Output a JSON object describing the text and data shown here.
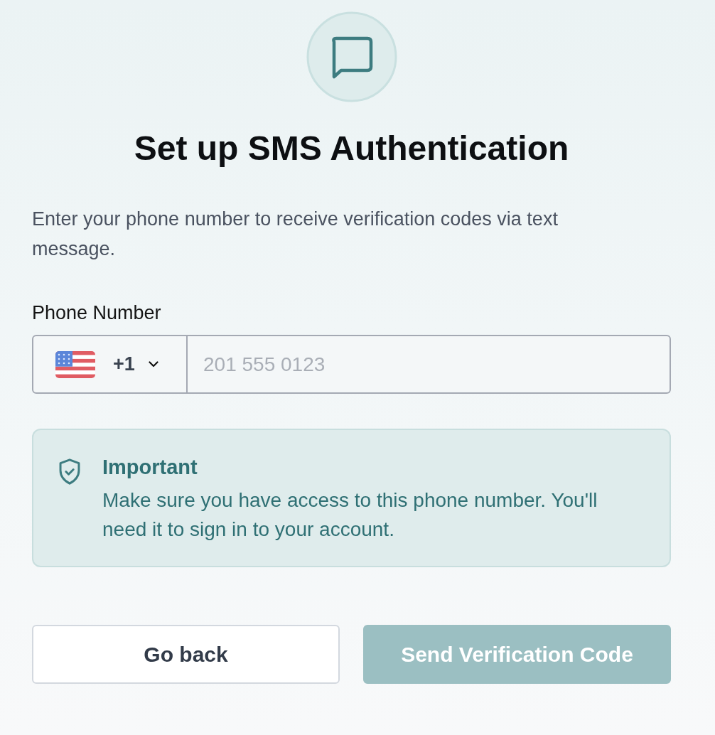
{
  "header": {
    "title": "Set up SMS Authentication",
    "description": "Enter your phone number to receive verification codes via text message."
  },
  "phone": {
    "label": "Phone Number",
    "country_code": "+1",
    "placeholder": "201 555 0123"
  },
  "notice": {
    "title": "Important",
    "text": "Make sure you have access to this phone number. You'll need it to sign in to your account."
  },
  "buttons": [
    {
      "label": "Go back",
      "kind": "secondary",
      "disabled": false
    },
    {
      "label": "Send Verification Code",
      "kind": "primary",
      "disabled": true
    }
  ]
}
